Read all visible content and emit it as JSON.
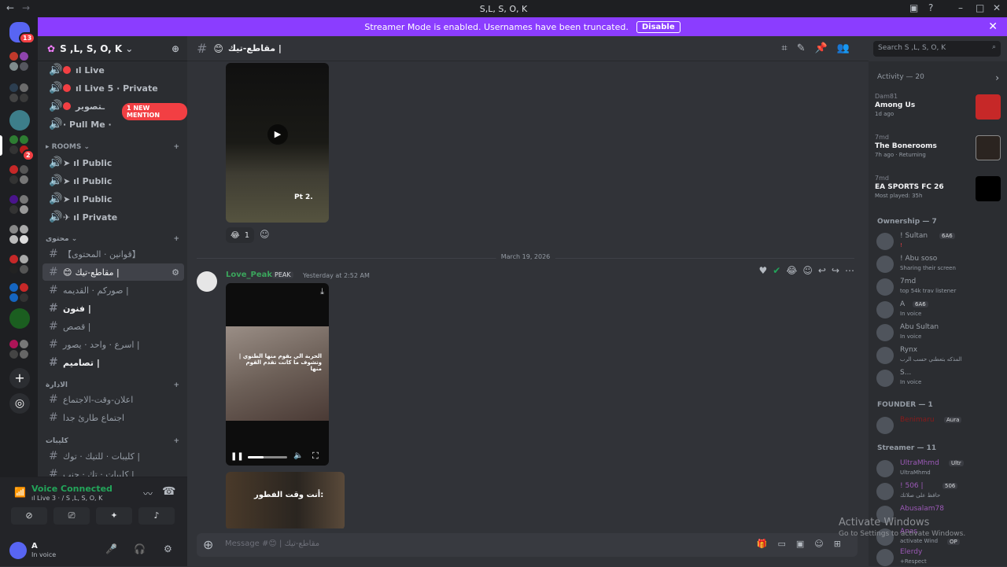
{
  "window": {
    "title": "S,L, S, O, K"
  },
  "banner": {
    "text": "Streamer Mode is enabled. Usernames have been truncated.",
    "button": "Disable"
  },
  "server_rail": {
    "mention_badge": "13",
    "dm_badge": "2"
  },
  "guild": {
    "name": "S ,L, S, O, K"
  },
  "channels": {
    "voice_top": [
      {
        "label": "ıl Live",
        "unread": true
      },
      {
        "label": "ıl Live 5 · Private",
        "unread": true
      },
      {
        "label": "ـتصوير",
        "unread": true
      },
      {
        "label": "· Pull Me ·"
      }
    ],
    "new_mention": "1 NEW MENTION",
    "rooms_label": "ROOMS",
    "rooms": [
      {
        "label": "ıl Public"
      },
      {
        "label": "ıl Public"
      },
      {
        "label": "ıl Public"
      },
      {
        "label": "ıl Private"
      }
    ],
    "cat2_label": "محتوى",
    "text_channels": [
      {
        "label": "【قوانين · المحتوى】"
      },
      {
        "label": "مقاطع-تيك |"
      },
      {
        "label": "صوركم · القديمه |"
      },
      {
        "label": "فنون |"
      },
      {
        "label": "قصص |"
      },
      {
        "label": "اسرع · واحد · يصور |"
      },
      {
        "label": "تصاميم |"
      }
    ],
    "cat3_label": "الادارة",
    "admin_channels": [
      {
        "label": "اعلان-وقت-الاجتماع"
      },
      {
        "label": "اجتماع طارئ جدا"
      }
    ],
    "cat4_label": "كليبات",
    "clip_channels": [
      {
        "label": "كليبات · للتيك · توك |"
      },
      {
        "label": "كليبات · تك · جنب |"
      }
    ]
  },
  "voice": {
    "status": "Voice Connected",
    "location": "ıl Live 3 · / S ,L, S, O, K"
  },
  "user": {
    "name": "A",
    "status": "In voice"
  },
  "chat": {
    "channel_name": "مقاطع-تيك |",
    "search_placeholder": "Search S ,L, S, O, K",
    "video1_caption": "Pt 2.",
    "reaction_count": "1",
    "date_divider": "March 19, 2026",
    "message": {
      "author": "Love_Peaks",
      "tag": "PEAK",
      "timestamp": "Yesterday at 2:52 AM"
    },
    "video2_caption": "الحربة الي بقوم منها الطنوي | وتشوف ما كانت تقدم القوم منها",
    "video3_caption": "أنت وقت الفطور:",
    "input_placeholder": "Message #😊 | مقاطع-تيك"
  },
  "members": {
    "activity_header": "Activity — 20",
    "activities": [
      {
        "who": "Dam81",
        "game": "Among Us",
        "meta": "1d ago"
      },
      {
        "who": "7md",
        "game": "The Bonerooms",
        "meta": "7h ago · Returning"
      },
      {
        "who": "7md",
        "game": "EA SPORTS FC 26",
        "meta": "Most played: 35h"
      }
    ],
    "ownership_header": "Ownership — 7",
    "owners": [
      {
        "name": "! Sultan",
        "tag": "6A6",
        "status": "!"
      },
      {
        "name": "! Abu soso",
        "status": "Sharing their screen"
      },
      {
        "name": "7md",
        "status": "top 54k trav listener"
      },
      {
        "name": "A",
        "tag": "6A6",
        "status": "In voice"
      },
      {
        "name": "Abu Sultan",
        "status": "In voice"
      },
      {
        "name": "Rynx",
        "status": "المذكه بتعطني حسب الرب"
      },
      {
        "name": "S...",
        "status": "In voice"
      }
    ],
    "founder_header": "FOUNDER — 1",
    "founders": [
      {
        "name": "Benimaru",
        "tag": "Aura"
      }
    ],
    "streamer_header": "Streamer — 11",
    "streamers": [
      {
        "name": "UltraMhmd",
        "tag": "Ultr",
        "status": "UltraMhmd"
      },
      {
        "name": "! 506 |",
        "tag": "506",
        "status": "حافظ على صلاتك"
      },
      {
        "name": "Abusalam78",
        "status": ""
      },
      {
        "name": "Anas",
        "tag": "OP",
        "status": "activate Wind"
      },
      {
        "name": "Elerdy",
        "status": "+Respect"
      }
    ]
  },
  "watermark": {
    "line1": "Activate Windows",
    "line2": "Go to Settings to activate Windows."
  }
}
